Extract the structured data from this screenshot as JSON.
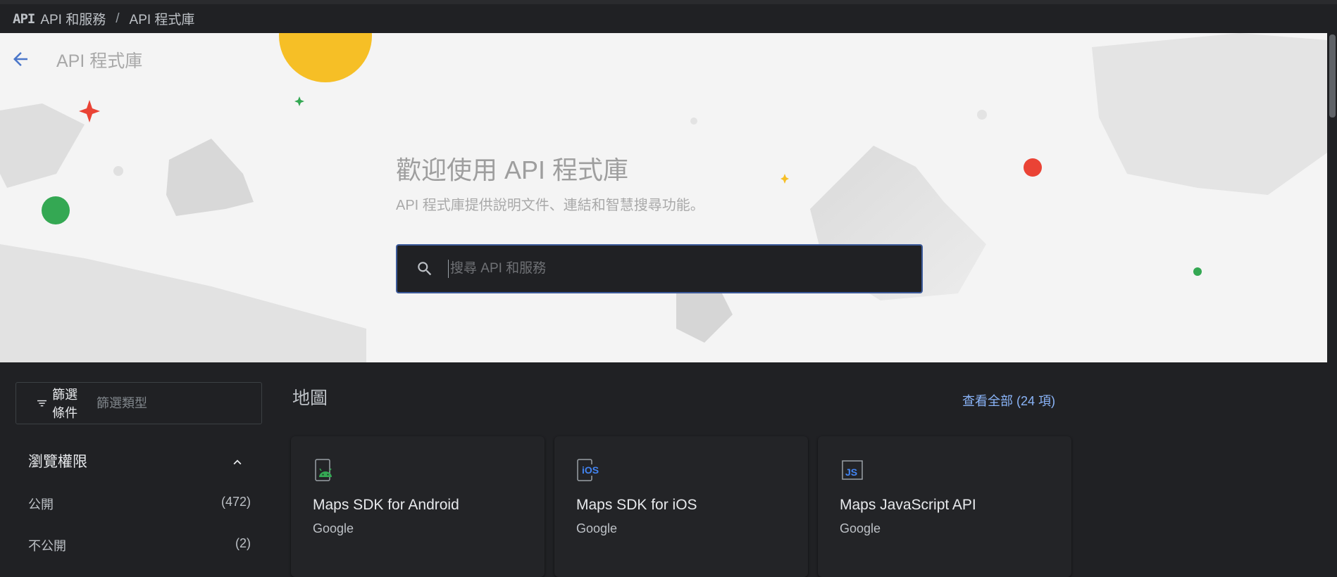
{
  "topbar": {
    "logo_text": "API",
    "crumb1": "API 和服務",
    "separator": "/",
    "crumb2": "API 程式庫"
  },
  "hero": {
    "page_title": "API 程式庫",
    "headline": "歡迎使用 API 程式庫",
    "subheadline": "API 程式庫提供說明文件、連結和智慧搜尋功能。",
    "search_placeholder": "搜尋 API 和服務"
  },
  "filter": {
    "label": "篩選條件",
    "placeholder": "篩選類型"
  },
  "sidebar": {
    "visibility_title": "瀏覽權限",
    "rows": [
      {
        "label": "公開",
        "count": "(472)"
      },
      {
        "label": "不公開",
        "count": "(2)"
      }
    ]
  },
  "section": {
    "title": "地圖",
    "view_all": "查看全部 (24 項)"
  },
  "cards": [
    {
      "title": "Maps SDK for Android",
      "publisher": "Google",
      "icon": "android-icon"
    },
    {
      "title": "Maps SDK for iOS",
      "publisher": "Google",
      "icon": "ios-icon",
      "icon_text": "iOS"
    },
    {
      "title": "Maps JavaScript API",
      "publisher": "Google",
      "icon": "javascript-icon",
      "icon_text": "JS"
    }
  ],
  "colors": {
    "accent": "#8ab4f8",
    "background": "#202124",
    "hero_background": "#f4f4f4",
    "search_border": "#3c5a9a"
  }
}
